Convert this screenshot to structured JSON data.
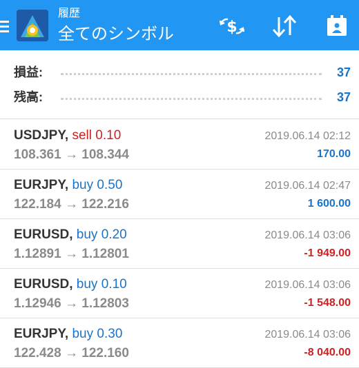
{
  "header": {
    "subtitle": "履歴",
    "title": "全てのシンボル",
    "icons": [
      "menu-icon",
      "metatrader-logo-icon",
      "dollar-exchange-icon",
      "sort-icon",
      "calendar-icon"
    ]
  },
  "summary": {
    "profit_label": "損益:",
    "profit_value": "37",
    "balance_label": "残高:",
    "balance_value": "37"
  },
  "trades": [
    {
      "symbol": "USDJPY,",
      "side": "sell",
      "volume": "0.10",
      "open": "108.361",
      "arrow": "→",
      "close": "108.344",
      "time": "2019.06.14 02:12",
      "profit": "170.00",
      "profit_sign": "pos"
    },
    {
      "symbol": "EURJPY,",
      "side": "buy",
      "volume": "0.50",
      "open": "122.184",
      "arrow": "→",
      "close": "122.216",
      "time": "2019.06.14 02:47",
      "profit": "1 600.00",
      "profit_sign": "pos"
    },
    {
      "symbol": "EURUSD,",
      "side": "buy",
      "volume": "0.20",
      "open": "1.12891",
      "arrow": "→",
      "close": "1.12801",
      "time": "2019.06.14 03:06",
      "profit": "-1 949.00",
      "profit_sign": "neg"
    },
    {
      "symbol": "EURUSD,",
      "side": "buy",
      "volume": "0.10",
      "open": "1.12946",
      "arrow": "→",
      "close": "1.12803",
      "time": "2019.06.14 03:06",
      "profit": "-1 548.00",
      "profit_sign": "neg"
    },
    {
      "symbol": "EURJPY,",
      "side": "buy",
      "volume": "0.30",
      "open": "122.428",
      "arrow": "→",
      "close": "122.160",
      "time": "2019.06.14 03:06",
      "profit": "-8 040.00",
      "profit_sign": "neg"
    }
  ],
  "colors": {
    "appbar": "#2196f3",
    "buy": "#1a73c8",
    "sell": "#cc2222",
    "muted": "#8a8a8a"
  }
}
